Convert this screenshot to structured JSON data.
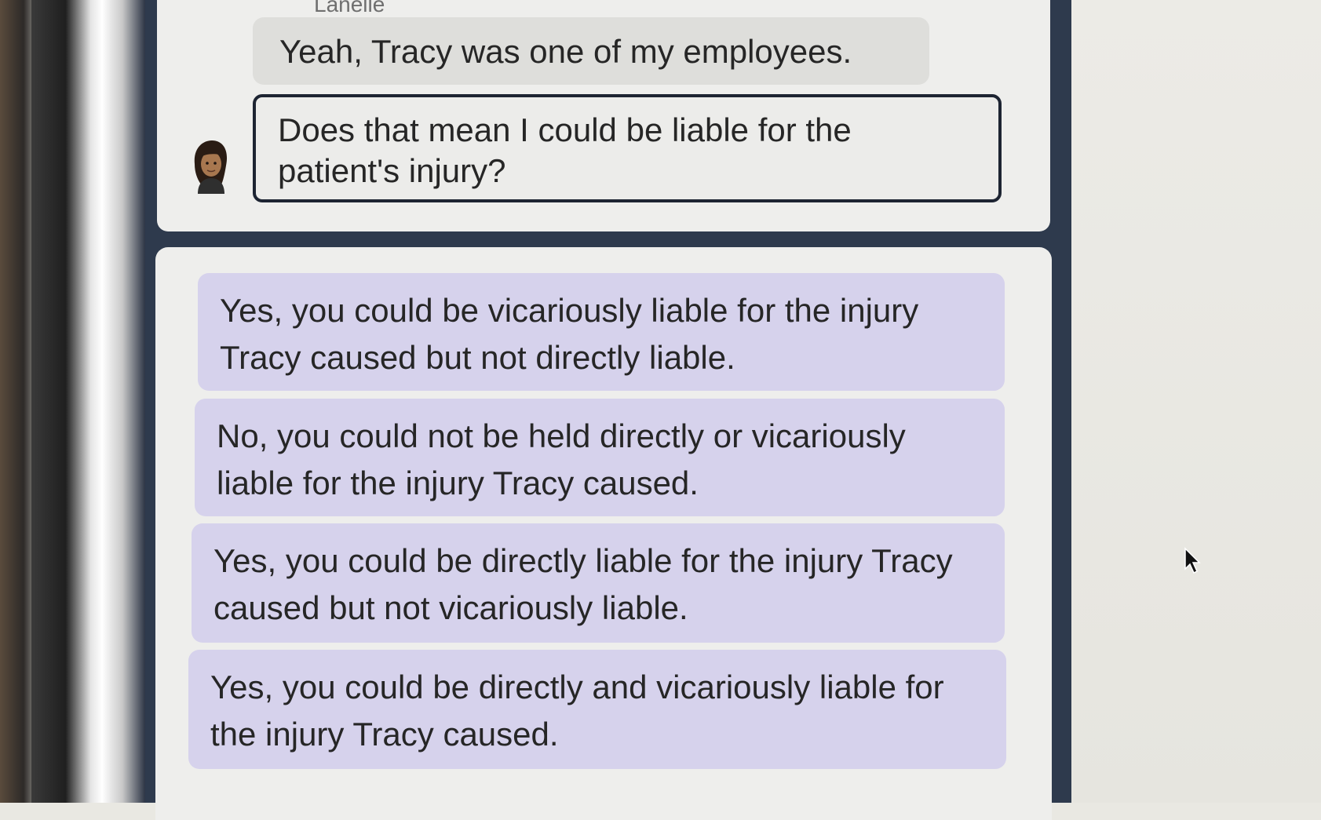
{
  "chat": {
    "speaker_name": "Lanelle",
    "messages": [
      {
        "text": "Yeah, Tracy was one of my employees."
      },
      {
        "text": "Does that mean I could be liable for the patient's injury?"
      }
    ]
  },
  "answers": {
    "options": [
      {
        "label": "Yes, you could be vicariously liable for the injury Tracy caused but not directly liable."
      },
      {
        "label": "No, you could not be held directly or vicariously liable for the injury Tracy caused."
      },
      {
        "label": "Yes, you could be directly liable for the injury Tracy caused but not vicariously liable."
      },
      {
        "label": "Yes, you could be directly and vicariously liable for the injury Tracy caused."
      }
    ]
  },
  "icons": {
    "avatar": "avatar-icon",
    "cursor": "mouse-cursor-icon"
  },
  "colors": {
    "answer_background": "#d6d2ec",
    "frame": "#2e3a4d",
    "panel": "#eeeeec"
  }
}
